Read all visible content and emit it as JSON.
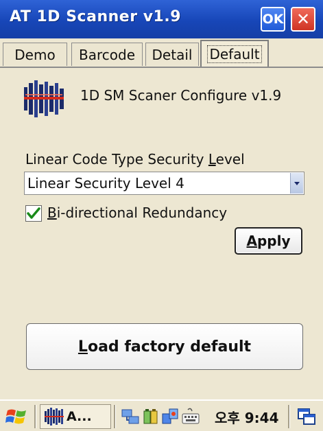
{
  "window": {
    "title": "AT 1D Scanner v1.9",
    "ok_label": "OK",
    "close_label": "✕"
  },
  "tabs": [
    {
      "label": "Demo",
      "active": false
    },
    {
      "label": "Barcode",
      "active": false
    },
    {
      "label": "Detail",
      "active": false
    },
    {
      "label": "Default",
      "active": true
    }
  ],
  "content": {
    "app_icon": "barcode-scanner-icon",
    "heading": "1D SM Scaner Configure v1.9",
    "security_label_prefix": "Linear Code Type Security ",
    "security_label_mnemonic": "L",
    "security_label_suffix": "evel",
    "security_level": {
      "selected": "Linear Security Level 4"
    },
    "bidirectional": {
      "checked": true,
      "label_mnemonic": "B",
      "label_rest": "i-directional Redundancy"
    },
    "apply": {
      "mnemonic": "A",
      "rest": "pply"
    },
    "load_default": {
      "mnemonic": "L",
      "rest": "oad factory default"
    }
  },
  "taskbar": {
    "start_icon": "windows-flag-icon",
    "task_label": "A...",
    "task_icon": "barcode-scanner-icon",
    "tray_icons": [
      "network-icon",
      "battery-icon",
      "sync-icon",
      "keyboard-icon"
    ],
    "clock": "오후 9:44",
    "desktop_icon": "show-desktop-icon"
  },
  "colors": {
    "titlebar": "#1746b8",
    "background": "#ede7d2",
    "ok_button": "#215bd8",
    "close_button": "#cf3424",
    "check": "#1a8a1a"
  }
}
